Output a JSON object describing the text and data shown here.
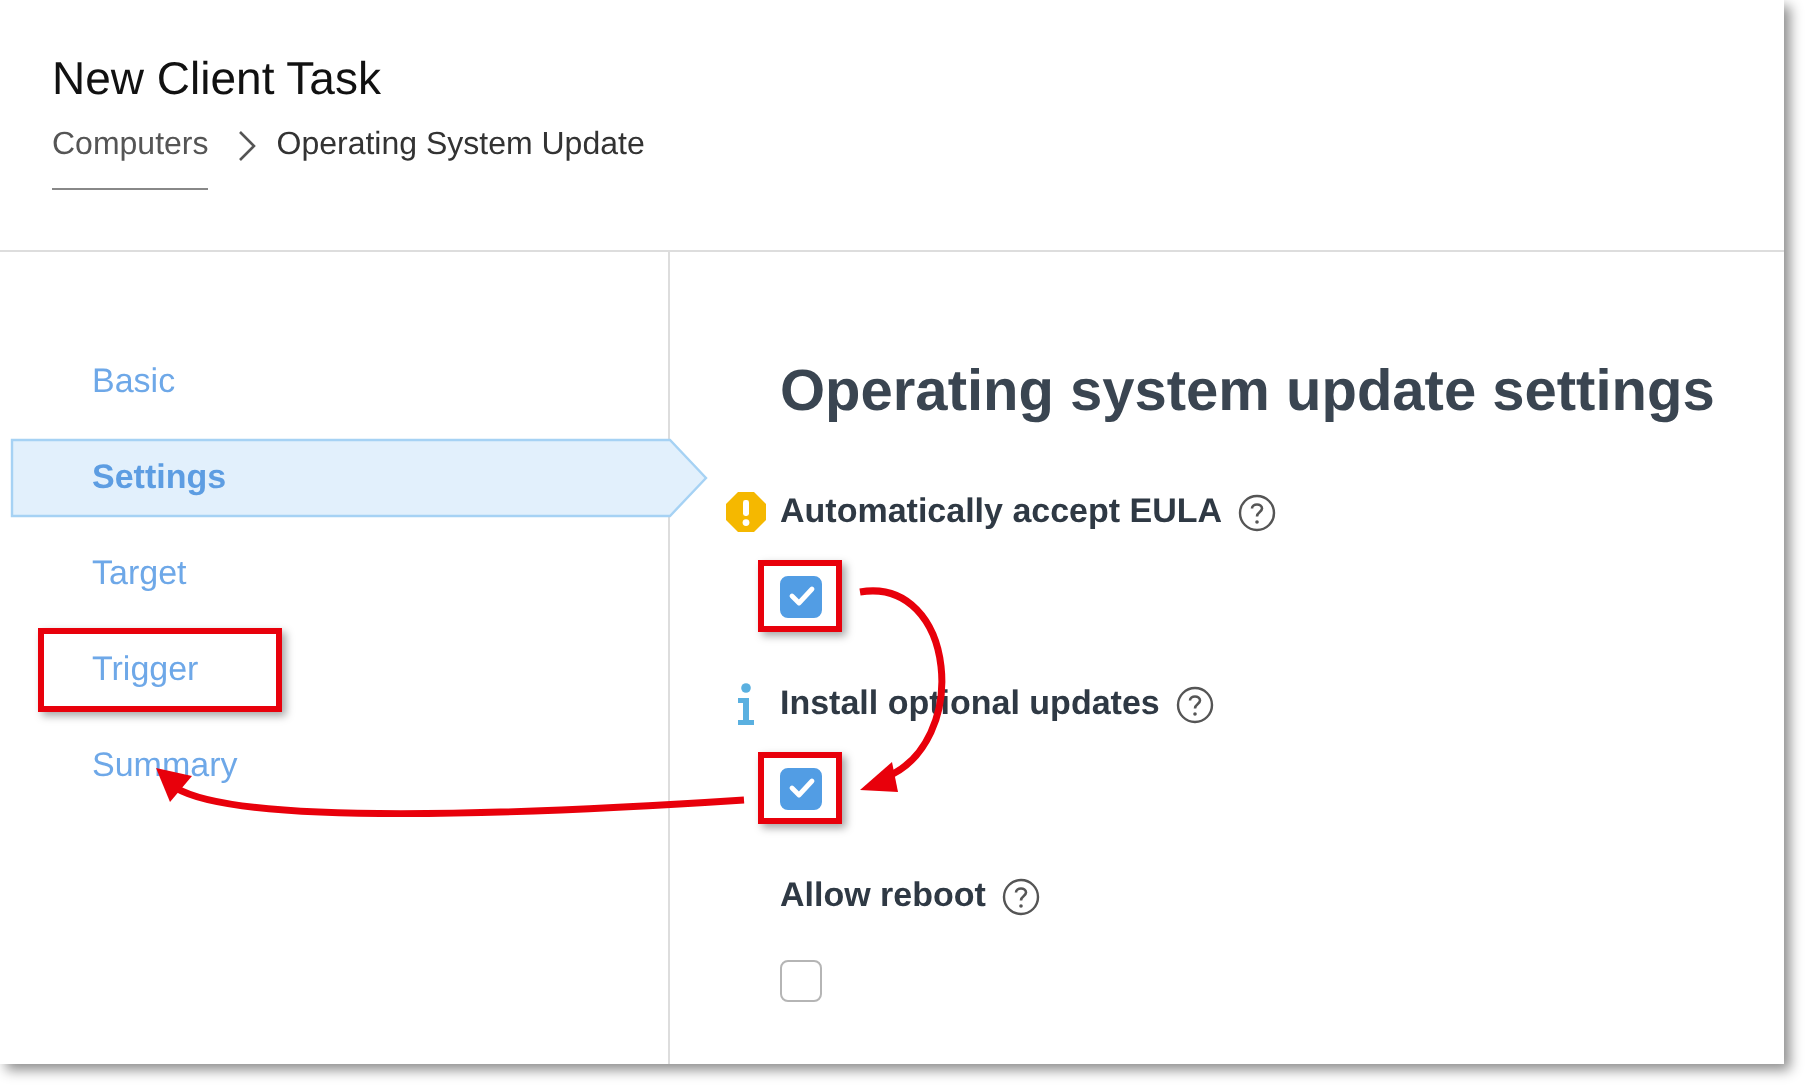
{
  "header": {
    "title": "New Client Task",
    "breadcrumb": [
      {
        "label": "Computers",
        "link": true
      },
      {
        "label": "Operating System Update",
        "link": false
      }
    ]
  },
  "steps": [
    {
      "label": "Basic",
      "selected": false,
      "highlighted": false
    },
    {
      "label": "Settings",
      "selected": true,
      "highlighted": false
    },
    {
      "label": "Target",
      "selected": false,
      "highlighted": false
    },
    {
      "label": "Trigger",
      "selected": false,
      "highlighted": true
    },
    {
      "label": "Summary",
      "selected": false,
      "highlighted": false
    }
  ],
  "section": {
    "title": "Operating system update settings",
    "options": [
      {
        "kind": "warning",
        "label": "Automatically accept EULA",
        "checked": true,
        "highlighted": true
      },
      {
        "kind": "info",
        "label": "Install optional updates",
        "checked": true,
        "highlighted": true
      },
      {
        "kind": "plain",
        "label": "Allow reboot",
        "checked": false,
        "highlighted": false
      }
    ]
  }
}
